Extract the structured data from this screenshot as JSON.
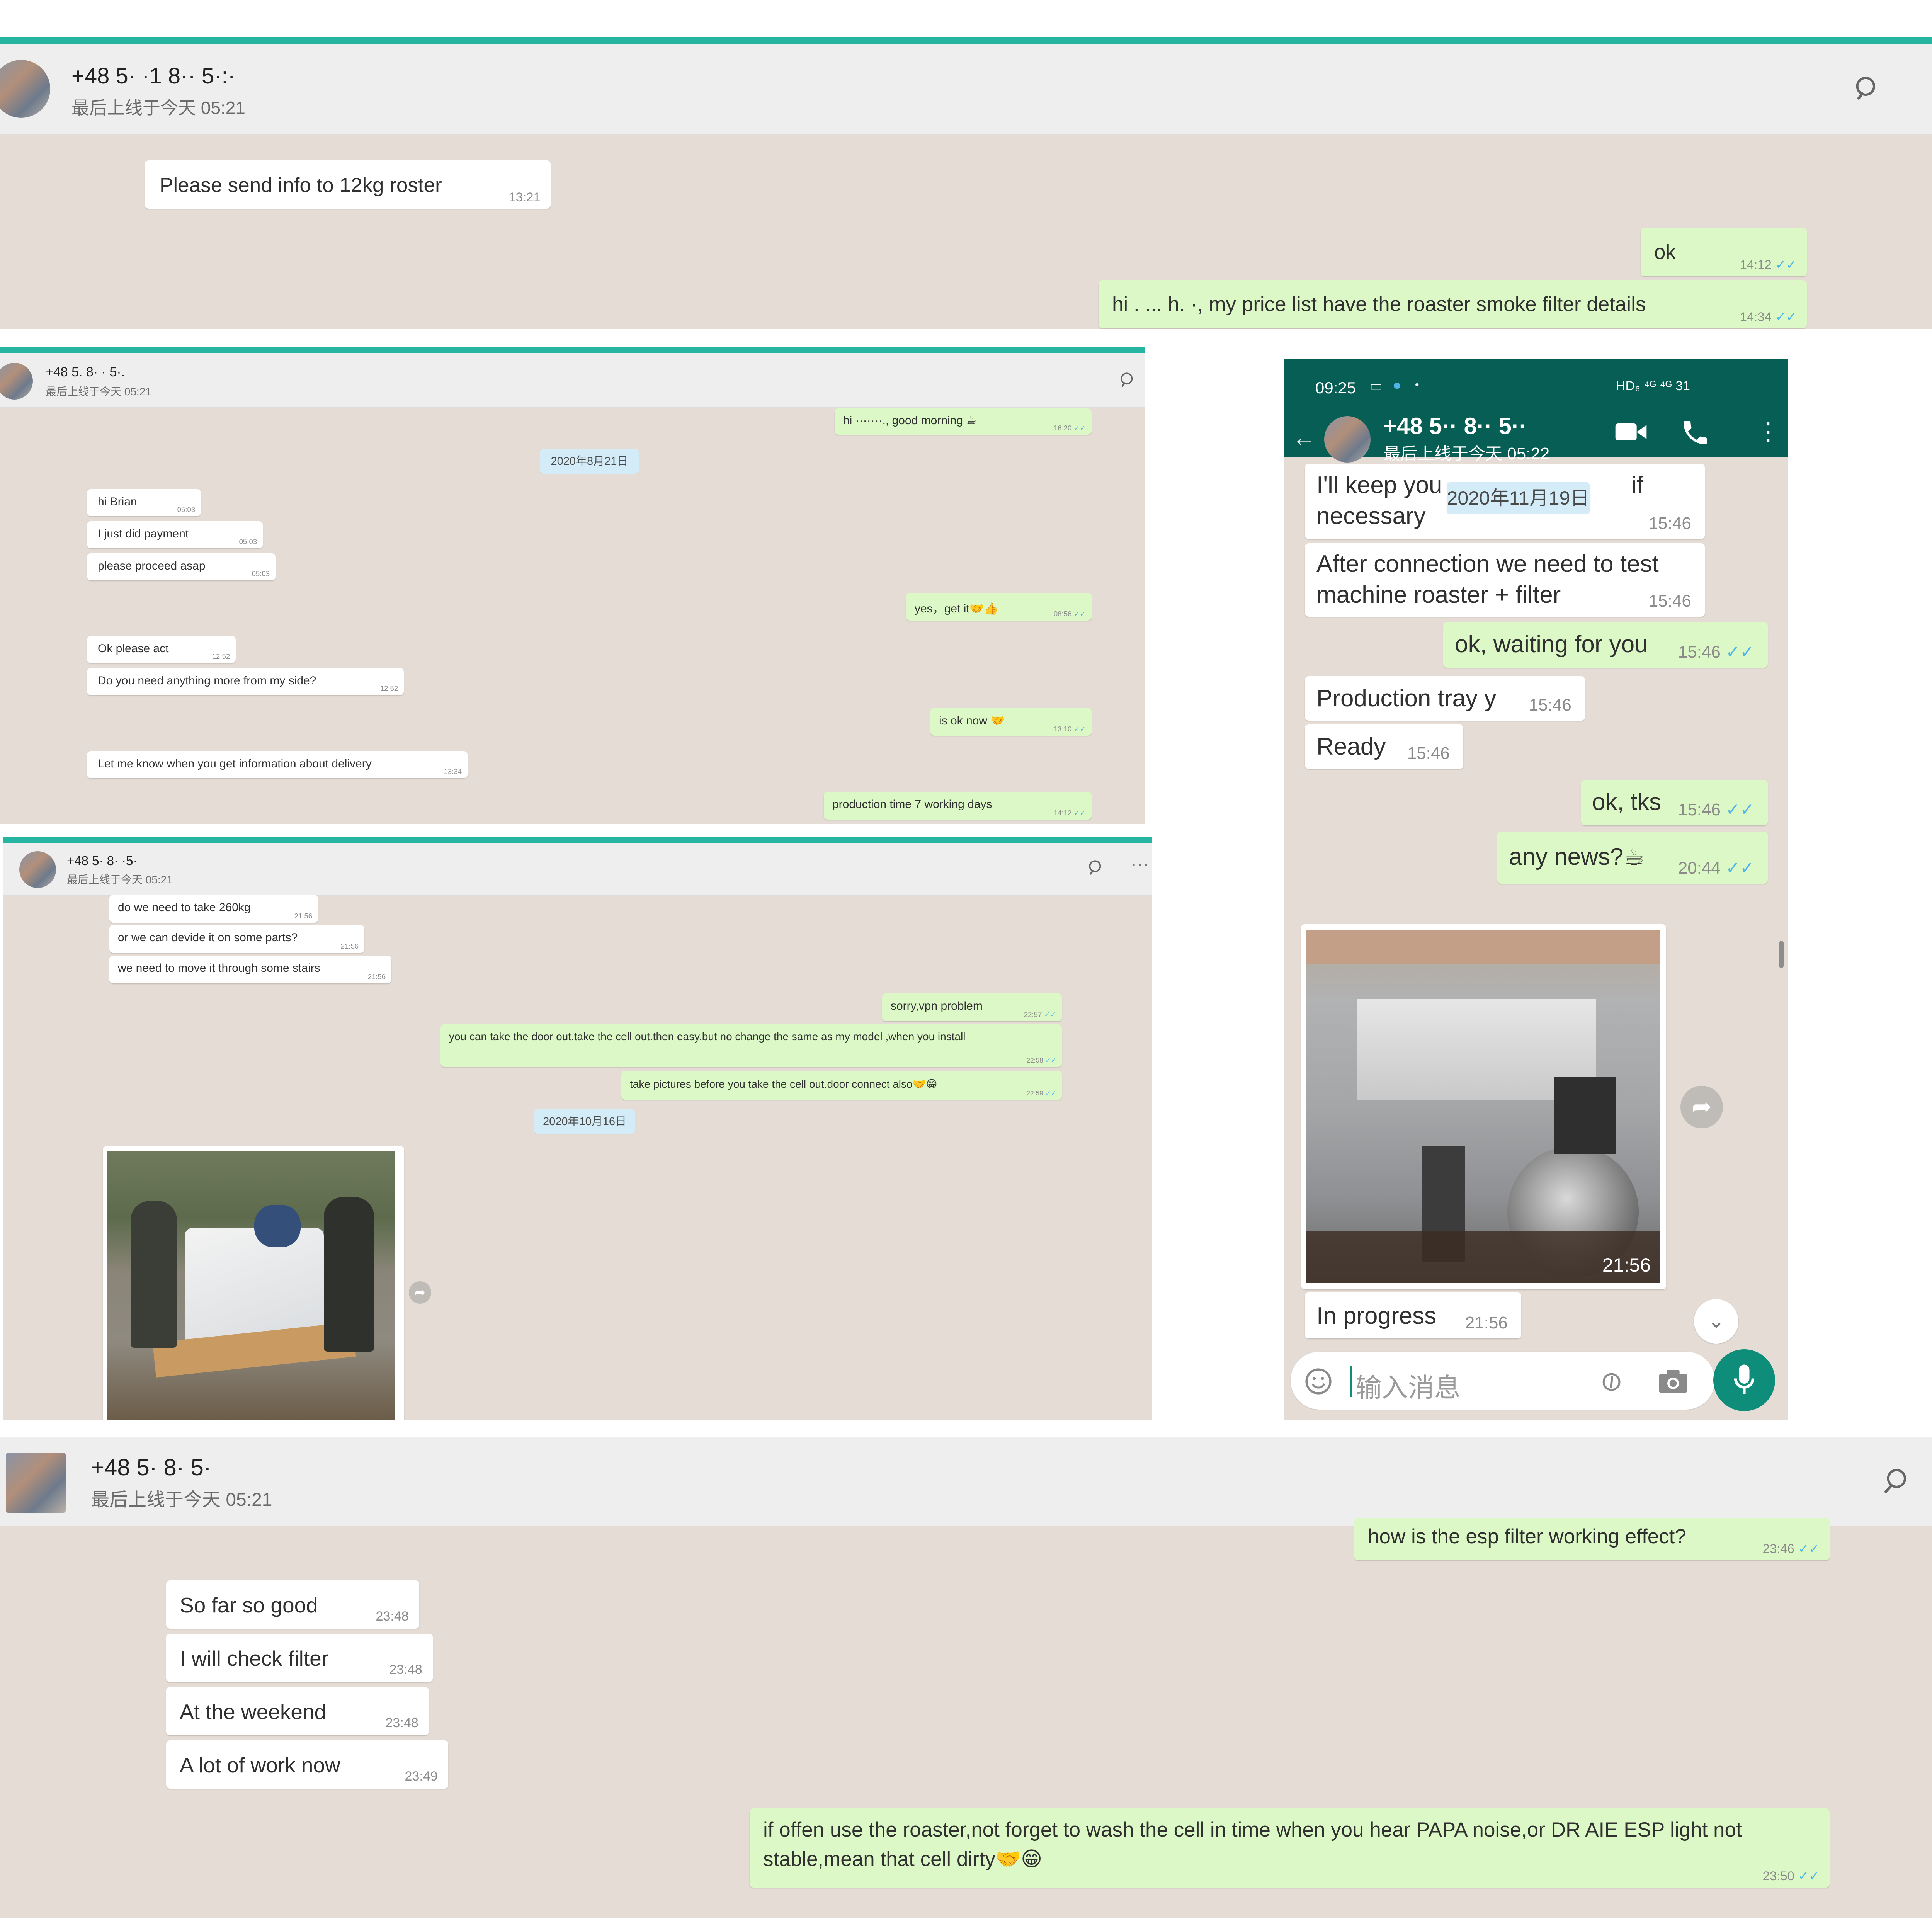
{
  "panel1": {
    "contact": "+48 5· ·1 8·· 5·:·",
    "last_seen": "最后上线于今天 05:21",
    "messages": [
      {
        "text": "Please send info to 12kg roster",
        "time": "13:21"
      },
      {
        "text": "ok",
        "time": "14:12",
        "checks": "✓✓"
      },
      {
        "text": "hi . ... h. ·, my price list have the roaster smoke filter details",
        "time": "14:34",
        "checks": "✓✓"
      }
    ]
  },
  "panel2": {
    "contact": "+48 5. 8· · 5·.",
    "last_seen": "最后上线于今天 05:21",
    "date_chip": "2020年8月21日",
    "messages": [
      {
        "text": "hi ·······., good morning ☕",
        "time": "16:20",
        "checks": "✓✓"
      },
      {
        "text": "hi Brian",
        "time": "05:03"
      },
      {
        "text": "I just did payment",
        "time": "05:03"
      },
      {
        "text": "please proceed asap",
        "time": "05:03"
      },
      {
        "text": "yes，get it🤝👍",
        "time": "08:56",
        "checks": "✓✓"
      },
      {
        "text": "Ok please act",
        "time": "12:52"
      },
      {
        "text": "Do you need anything more from my side?",
        "time": "12:52"
      },
      {
        "text": "is ok now 🤝",
        "time": "13:10",
        "checks": "✓✓"
      },
      {
        "text": "Let me know when you get information about delivery",
        "time": "13:34"
      },
      {
        "text": "production time 7 working days",
        "time": "14:12",
        "checks": "✓✓"
      }
    ]
  },
  "panel3": {
    "contact": "+48 5· 8· ·5·",
    "last_seen": "最后上线于今天 05:21",
    "date_chip": "2020年10月16日",
    "messages": [
      {
        "text": "do we need to take 260kg",
        "time": "21:56"
      },
      {
        "text": "or we can devide it on some parts?",
        "time": "21:56"
      },
      {
        "text": "we need to move it through some stairs",
        "time": "21:56"
      },
      {
        "text": "sorry,vpn problem",
        "time": "22:57",
        "checks": "✓✓"
      },
      {
        "text": "you can take the door out.take the cell out.then easy.but no change the same as my model ,when you install",
        "time": "22:58",
        "checks": "✓✓"
      },
      {
        "text": "take pictures before you take the cell out.door connect also🤝😁",
        "time": "22:59",
        "checks": "✓✓"
      }
    ]
  },
  "phone": {
    "status_time": "09:25",
    "status_right": "HD₆ ⁴ᴳ ⁴ᴳ 31",
    "contact": "+48 5·· 8·· 5··",
    "last_seen": "最后上线于今天 05:22",
    "date_chip": "2020年11月19日",
    "messages": [
      {
        "text_line1": "I'll keep you",
        "text_line1b": "if",
        "text_line2": "necessary",
        "time": "15:46"
      },
      {
        "text_line1": "After connection we need to test",
        "text_line2": "machine roaster + filter",
        "time": "15:46"
      },
      {
        "text": "ok, waiting for you",
        "time": "15:46",
        "checks": "✓✓"
      },
      {
        "text": "Production tray y",
        "time": "15:46"
      },
      {
        "text": "Ready",
        "time": "15:46"
      },
      {
        "text": "ok, tks",
        "time": "15:46",
        "checks": "✓✓"
      },
      {
        "text": "any news?☕",
        "time": "20:44",
        "checks": "✓✓"
      },
      {
        "text": "In progress",
        "time": "21:56"
      }
    ],
    "photo_time": "21:56",
    "input_placeholder": "输入消息"
  },
  "panel4": {
    "contact": "+48 5· 8· 5·",
    "last_seen": "最后上线于今天 05:21",
    "messages": [
      {
        "text": "how is the esp filter working effect?",
        "time": "23:46",
        "checks": "✓✓"
      },
      {
        "text": "So far so good",
        "time": "23:48"
      },
      {
        "text": "I will check filter",
        "time": "23:48"
      },
      {
        "text": "At the weekend",
        "time": "23:48"
      },
      {
        "text": "A lot of work now",
        "time": "23:49"
      },
      {
        "text_line1": "if offen use the roaster,not forget to wash the cell in time when you hear PAPA noise,or DR AIE ESP light not",
        "text_line2": "stable,mean that cell dirty🤝😁",
        "time": "23:50",
        "checks": "✓✓"
      }
    ]
  },
  "colors": {
    "chat_bg": "#e5ddd5",
    "incoming": "#ffffff",
    "outgoing": "#dcf8c6",
    "teal_bar": "#25b5a0",
    "whatsapp_dark": "#075e54",
    "read_check": "#4fb6ec"
  },
  "icons": [
    "search-icon",
    "more-icon",
    "back-arrow-icon",
    "video-call-icon",
    "phone-call-icon",
    "menu-dots-icon",
    "emoji-icon",
    "attach-icon",
    "camera-icon",
    "mic-icon",
    "forward-icon",
    "scroll-down-icon"
  ]
}
